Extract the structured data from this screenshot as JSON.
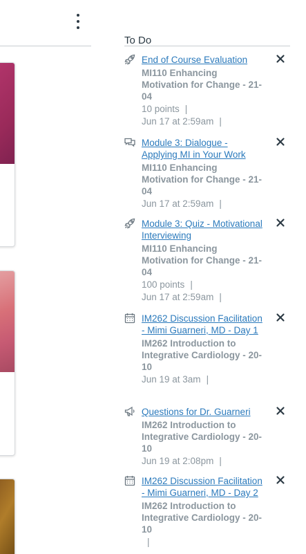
{
  "todo": {
    "title": "To Do",
    "items": [
      {
        "icon": "rocket-icon",
        "link": "End of Course Evaluation",
        "course": "MI110 Enhancing Motivation for Change - 21-04",
        "points": "10 points",
        "sep1": "|",
        "due": "Jun 17 at 2:59am",
        "sep2": "|"
      },
      {
        "icon": "discussion-icon",
        "link": "Module 3: Dialogue - Applying MI in Your Work",
        "course": "MI110 Enhancing Motivation for Change - 21-04",
        "due": "Jun 17 at 2:59am",
        "sep2": "|"
      },
      {
        "icon": "rocket-icon",
        "link": "Module 3: Quiz - Motivational Interviewing",
        "course": "MI110 Enhancing Motivation for Change - 21-04",
        "points": "100 points",
        "sep1": "|",
        "due": "Jun 17 at 2:59am",
        "sep2": "|"
      },
      {
        "icon": "calendar-icon",
        "link": "IM262 Discussion Facilitation - Mimi Guarneri, MD - Day 1",
        "course": "IM262 Introduction to Integrative Cardiology - 20-10",
        "due": "Jun 19 at 3am",
        "sep2": "|"
      },
      {
        "icon": "announcement-icon",
        "link": "Questions for Dr. Guarneri",
        "course": "IM262 Introduction to Integrative Cardiology - 20-10",
        "due": "Jun 19 at 2:08pm",
        "sep2": "|"
      },
      {
        "icon": "calendar-icon",
        "link": "IM262 Discussion Facilitation - Mimi Guarneri, MD - Day 2",
        "course": "IM262 Introduction to Integrative Cardiology - 20-10",
        "due": "",
        "sep2": "|"
      }
    ]
  },
  "colors": {
    "link": "#2b7abc",
    "muted": "#8b969e",
    "text": "#2d3b45"
  }
}
